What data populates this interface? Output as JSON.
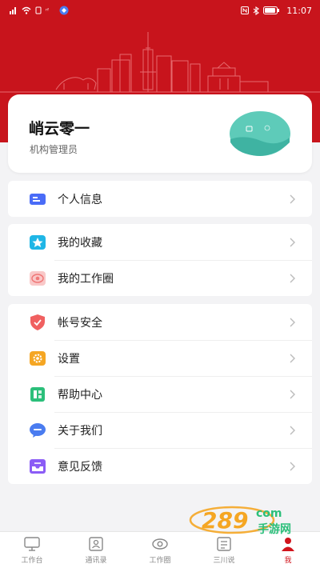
{
  "status_bar": {
    "time": "11:07"
  },
  "profile": {
    "name": "峭云零一",
    "role": "机构管理员"
  },
  "menu_groups": [
    {
      "items": [
        {
          "label": "个人信息",
          "icon": "id-card-icon",
          "color": "#4a6cf7"
        }
      ]
    },
    {
      "items": [
        {
          "label": "我的收藏",
          "icon": "star-icon",
          "color": "#1fb6e6"
        },
        {
          "label": "我的工作圈",
          "icon": "circle-eye-icon",
          "color": "#f07878"
        }
      ]
    },
    {
      "items": [
        {
          "label": "帐号安全",
          "icon": "shield-icon",
          "color": "#f06060"
        },
        {
          "label": "设置",
          "icon": "gear-icon",
          "color": "#f5a623"
        },
        {
          "label": "帮助中心",
          "icon": "help-book-icon",
          "color": "#2bbf7a"
        },
        {
          "label": "关于我们",
          "icon": "chat-bubble-icon",
          "color": "#4a7cf0"
        },
        {
          "label": "意见反馈",
          "icon": "inbox-icon",
          "color": "#8b5cf6"
        }
      ]
    }
  ],
  "tabs": [
    {
      "label": "工作台",
      "icon": "monitor-icon",
      "active": false
    },
    {
      "label": "通讯录",
      "icon": "contacts-icon",
      "active": false
    },
    {
      "label": "工作圈",
      "icon": "eye-icon",
      "active": false
    },
    {
      "label": "三川说",
      "icon": "news-icon",
      "active": false
    },
    {
      "label": "我",
      "icon": "person-icon",
      "active": true
    }
  ],
  "colors": {
    "brand_red": "#c8141c",
    "active_tab": "#d1141c"
  },
  "watermark": {
    "text": "289",
    "sub": "手游网",
    "domain": "com"
  }
}
